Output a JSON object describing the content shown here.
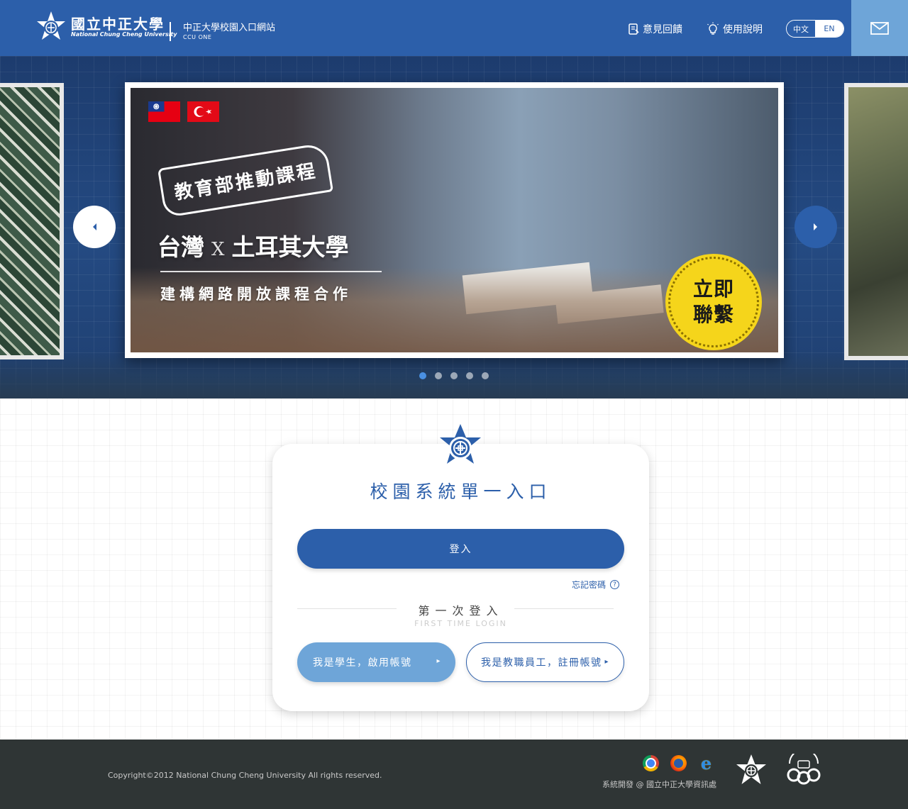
{
  "header": {
    "logo_zh": "國立中正大學",
    "logo_en": "National Chung Cheng University",
    "site_title": "中正大學校園入口網站",
    "site_subtitle": "CCU ONE",
    "nav": {
      "feedback_label": "意見回饋",
      "help_label": "使用說明"
    },
    "lang": {
      "zh_label": "中文",
      "en_label": "EN",
      "active": "中文"
    },
    "mail_icon": "mail-icon"
  },
  "banner": {
    "ribbon_text": "教育部推動課程",
    "headline_left": "台灣",
    "headline_x": "X",
    "headline_right": "土耳其大學",
    "subline": "建構網路開放課程合作",
    "contact_line1": "立即",
    "contact_line2": "聯繫",
    "flags": [
      "taiwan-flag",
      "turkey-flag"
    ],
    "slide_count": 5,
    "active_slide": 1
  },
  "login": {
    "title": "校園系統單一入口",
    "login_button": "登入",
    "forgot_password": "忘記密碼",
    "first_time_title": "第一次登入",
    "first_time_subtitle": "FIRST TIME LOGIN",
    "student_button": "我是學生，啟用帳號",
    "staff_button": "我是教職員工，註冊帳號"
  },
  "footer": {
    "copyright": "Copyright©2012 National Chung Cheng University All rights reserved.",
    "developer": "系統開發 @ 國立中正大學資訊處",
    "browsers": [
      "chrome-icon",
      "firefox-icon",
      "ie-icon"
    ]
  },
  "colors": {
    "primary": "#2c5faa",
    "light_blue": "#6ea5d8",
    "footer_bg": "#2f3535",
    "badge_yellow": "#f5d51b"
  }
}
